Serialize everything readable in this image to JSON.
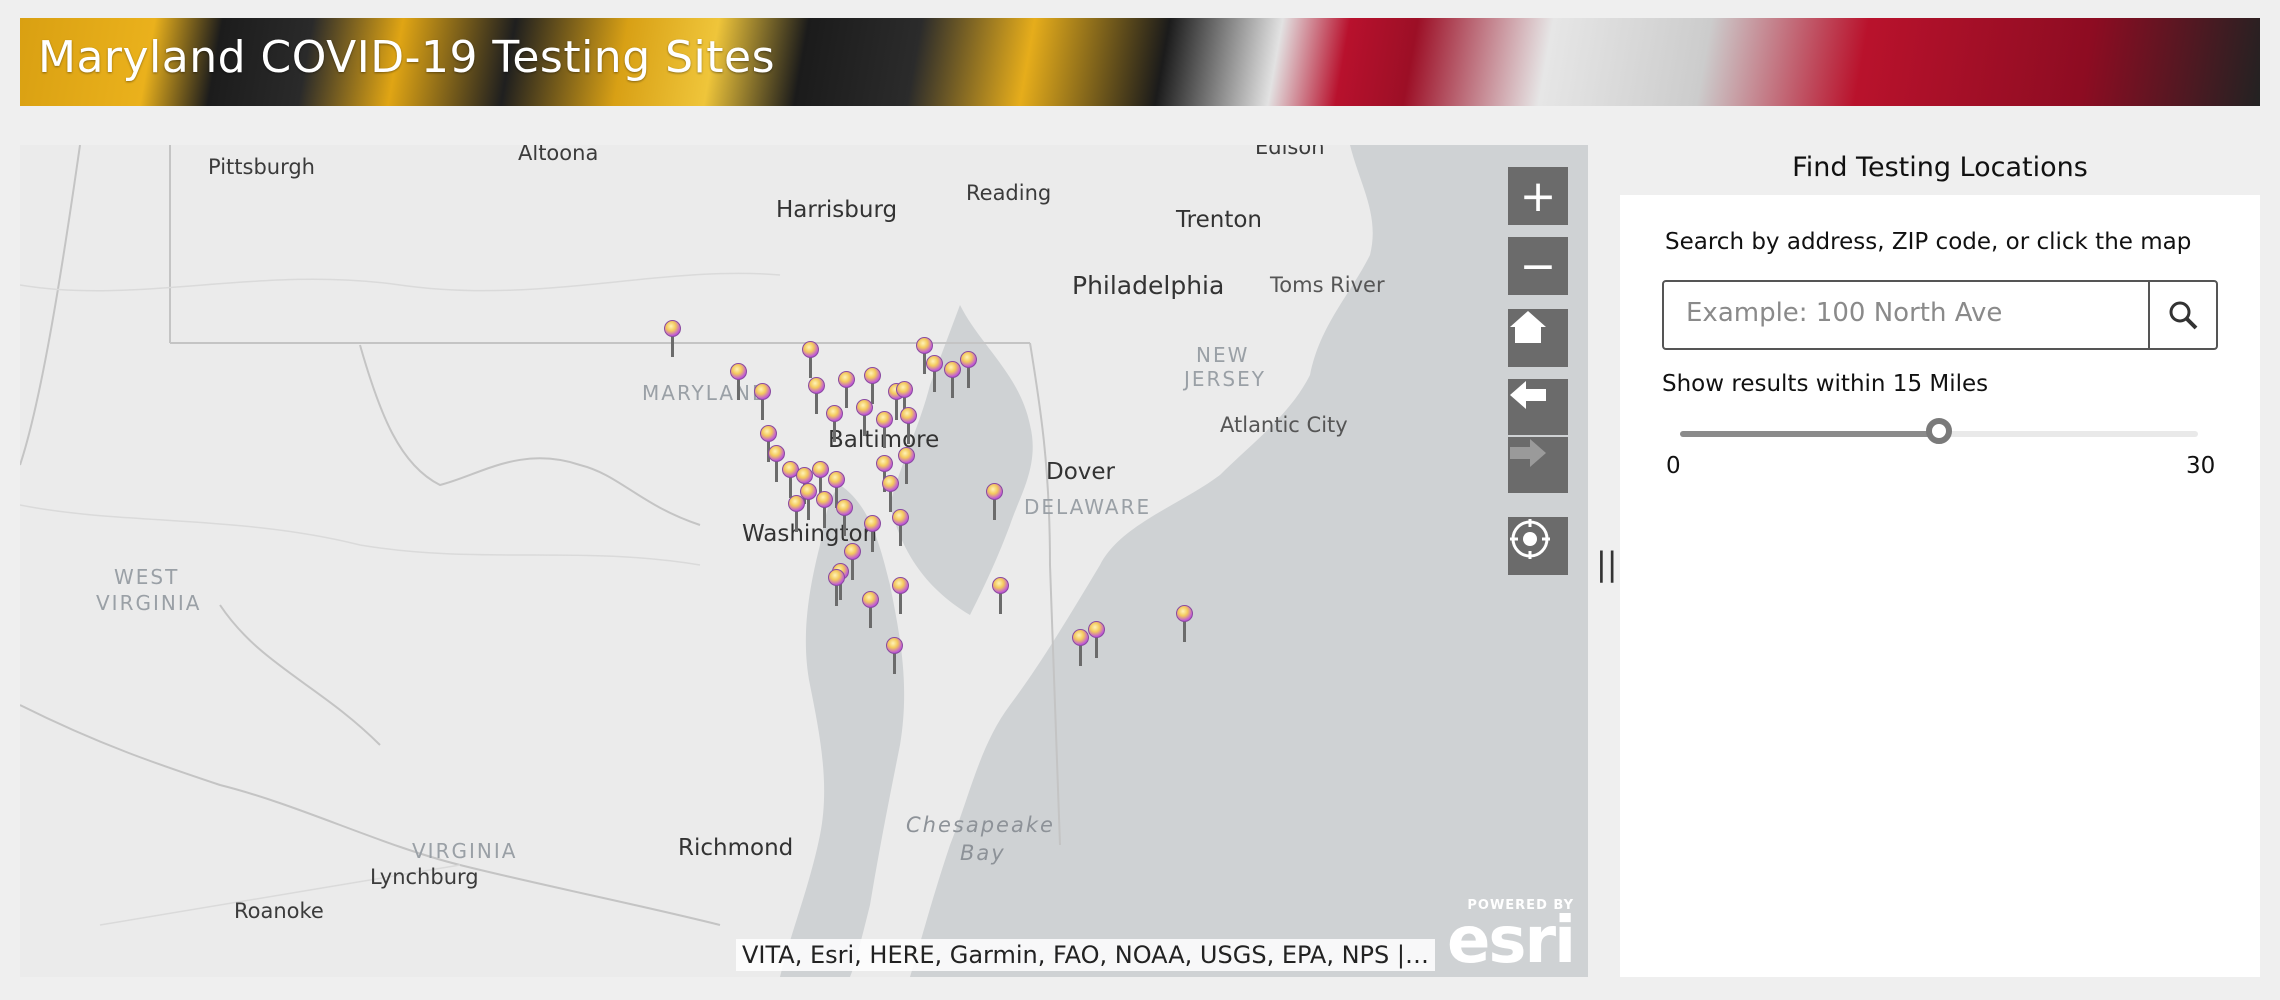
{
  "header": {
    "title": "Maryland COVID-19 Testing Sites"
  },
  "map": {
    "zoom_in": "+",
    "zoom_out": "−",
    "attribution": "VITA, Esri, HERE, Garmin, FAO, NOAA, USGS, EPA, NPS |…",
    "esri_powered": "POWERED BY",
    "esri_logo": "esri",
    "labels": {
      "pittsburgh": "Pittsburgh",
      "altoona": "Altoona",
      "edison": "Edison",
      "harrisburg": "Harrisburg",
      "reading": "Reading",
      "trenton": "Trenton",
      "philadelphia": "Philadelphia",
      "toms_river": "Toms River",
      "new_jersey_1": "NEW",
      "new_jersey_2": "JERSEY",
      "maryland": "MARYLAND",
      "baltimore": "Baltimore",
      "atlantic_city": "Atlantic City",
      "dover": "Dover",
      "delaware": "DELAWARE",
      "washington": "Washington",
      "west_virginia_1": "WEST",
      "west_virginia_2": "VIRGINIA",
      "virginia": "VIRGINIA",
      "richmond": "Richmond",
      "lynchburg": "Lynchburg",
      "roanoke": "Roanoke",
      "chesapeake_1": "Chesapeake",
      "chesapeake_2": "Bay"
    }
  },
  "panel": {
    "title": "Find Testing Locations",
    "prompt": "Search by address, ZIP code, or click the map",
    "search_placeholder": "Example: 100 North Ave",
    "radius_label": "Show results within 15 Miles",
    "slider_min": "0",
    "slider_max": "30",
    "slider_value": 15
  },
  "colors": {
    "map_bg": "#e5e6e7",
    "water": "#cfd2d4",
    "pin": "#b45ad0",
    "button": "#6b6b6b"
  }
}
